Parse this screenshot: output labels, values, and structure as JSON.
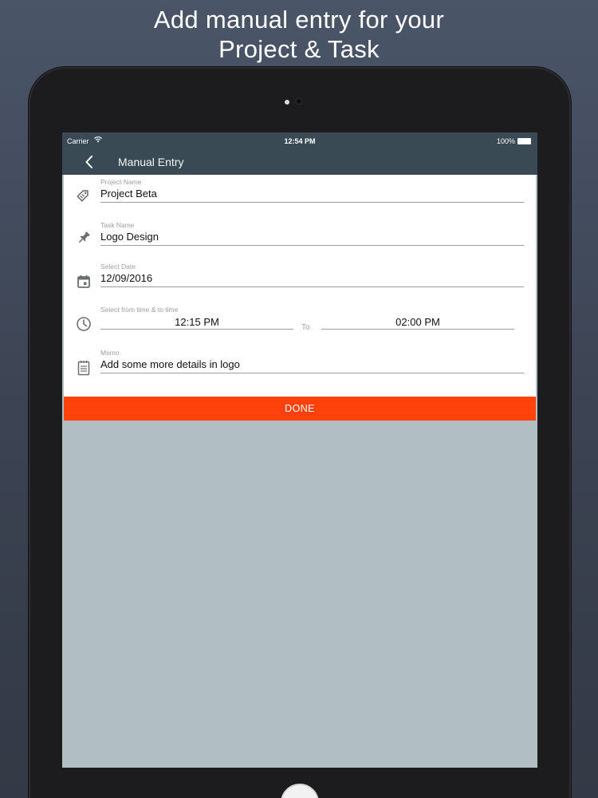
{
  "promo": {
    "line1": "Add manual entry for your",
    "line2": "Project & Task"
  },
  "statusbar": {
    "carrier": "Carrier",
    "wifi_icon": "wifi-icon",
    "time": "12:54 PM",
    "battery_percent": "100%",
    "battery_icon": "battery-icon"
  },
  "navbar": {
    "back_icon": "chevron-left-icon",
    "title": "Manual Entry"
  },
  "form": {
    "project": {
      "label": "Project Name",
      "value": "Project Beta",
      "icon": "tag-icon"
    },
    "task": {
      "label": "Task Name",
      "value": "Logo Design",
      "icon": "pin-icon"
    },
    "date": {
      "label": "Select Date",
      "value": "12/09/2016",
      "icon": "calendar-icon"
    },
    "time": {
      "label": "Select from time & to time",
      "from": "12:15 PM",
      "to_label": "To",
      "to": "02:00 PM",
      "icon": "clock-icon"
    },
    "memo": {
      "label": "Memo",
      "value": "Add some more details in logo",
      "icon": "notepad-icon"
    }
  },
  "done_button": {
    "label": "DONE"
  },
  "colors": {
    "navbar": "#394a54",
    "accent": "#ff420c",
    "screen_background": "#b1bfc5"
  }
}
